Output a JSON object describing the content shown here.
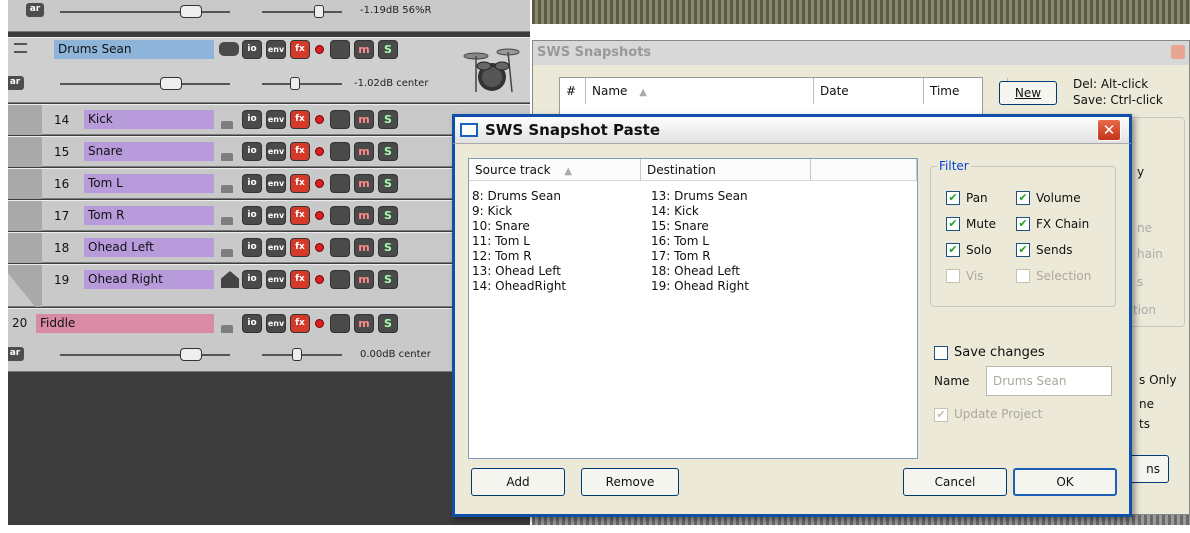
{
  "tracks_panel": {
    "top_partial": {
      "ar": "ar",
      "db": "-1.19dB 56%R"
    },
    "folder": {
      "name": "Drums Sean",
      "ar": "ar",
      "db": "-1.02dB center"
    },
    "children": [
      {
        "num": "14",
        "name": "Kick"
      },
      {
        "num": "15",
        "name": "Snare"
      },
      {
        "num": "16",
        "name": "Tom L"
      },
      {
        "num": "17",
        "name": "Tom R"
      },
      {
        "num": "18",
        "name": "Ohead Left"
      },
      {
        "num": "19",
        "name": "Ohead Right"
      }
    ],
    "fiddle": {
      "num": "20",
      "name": "Fiddle",
      "ar": "ar",
      "db": "0.00dB center"
    },
    "buttons": {
      "io": "io",
      "env": "env",
      "fx": "fx",
      "mute": "m",
      "solo": "S"
    }
  },
  "snapshots_window": {
    "title": "SWS Snapshots",
    "columns": {
      "num": "#",
      "name": "Name",
      "date": "Date",
      "time": "Time"
    },
    "new_button": "New",
    "hint_del": "Del: Alt-click",
    "hint_save": "Save: Ctrl-click",
    "fragments": [
      "y",
      "ne",
      "hain",
      "s",
      "tion",
      "s Only",
      "ne",
      "ts",
      "ns"
    ]
  },
  "paste_dialog": {
    "title": "SWS Snapshot Paste",
    "columns": {
      "source": "Source track",
      "destination": "Destination"
    },
    "rows": [
      {
        "source": "8: Drums Sean",
        "destination": "13: Drums Sean"
      },
      {
        "source": "9: Kick",
        "destination": "14: Kick"
      },
      {
        "source": "10: Snare",
        "destination": "15: Snare"
      },
      {
        "source": "11: Tom L",
        "destination": "16: Tom L"
      },
      {
        "source": "12: Tom R",
        "destination": "17: Tom R"
      },
      {
        "source": "13: Ohead Left",
        "destination": "18: Ohead Left"
      },
      {
        "source": "14: OheadRight",
        "destination": "19: Ohead Right"
      }
    ],
    "filter": {
      "legend": "Filter",
      "pan": "Pan",
      "volume": "Volume",
      "mute": "Mute",
      "fx_chain": "FX Chain",
      "solo": "Solo",
      "sends": "Sends",
      "vis": "Vis",
      "selection": "Selection"
    },
    "save_changes": "Save changes",
    "name_label": "Name",
    "name_value": "Drums Sean",
    "update_project": "Update Project",
    "buttons": {
      "add": "Add",
      "remove": "Remove",
      "cancel": "Cancel",
      "ok": "OK"
    }
  },
  "colors": {
    "folder_name": "#8fb4da",
    "child_name": "#b79bdb",
    "fiddle_name": "#d98ba6",
    "fx_button": "#d43a2a",
    "title_border": "#0f4ea9"
  }
}
